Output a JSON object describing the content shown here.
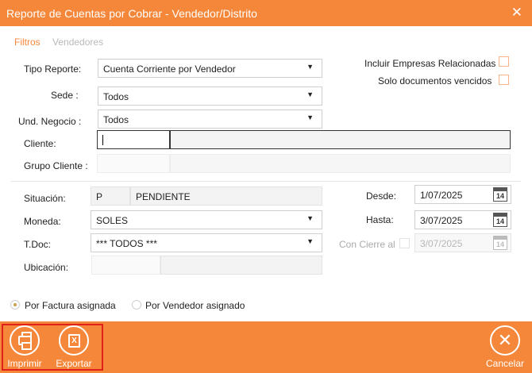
{
  "window": {
    "title": "Reporte de Cuentas por Cobrar - Vendedor/Distrito",
    "close_glyph": "✕"
  },
  "tabs": [
    {
      "label": "Filtros",
      "active": true
    },
    {
      "label": "Vendedores",
      "active": false
    }
  ],
  "form": {
    "tipo_reporte": {
      "label": "Tipo Reporte:",
      "value": "Cuenta Corriente por Vendedor"
    },
    "incluir_empresas": {
      "label": "Incluir Empresas Relacionadas",
      "checked": false
    },
    "solo_vencidos": {
      "label": "Solo documentos vencidos",
      "checked": false
    },
    "sede": {
      "label": "Sede :",
      "value": "Todos"
    },
    "und_negocio": {
      "label": "Und. Negocio :",
      "value": "Todos"
    },
    "cliente": {
      "label": "Cliente:",
      "code": "",
      "name": ""
    },
    "grupo_cliente": {
      "label": "Grupo Cliente :",
      "code": "",
      "name": ""
    },
    "situacion": {
      "label": "Situación:",
      "code": "P",
      "name": "PENDIENTE"
    },
    "moneda": {
      "label": "Moneda:",
      "value": "SOLES"
    },
    "tdoc": {
      "label": "T.Doc:",
      "value": "*** TODOS ***"
    },
    "ubicacion": {
      "label": "Ubicación:",
      "code": "",
      "name": ""
    },
    "desde": {
      "label": "Desde:",
      "value": "1/07/2025"
    },
    "hasta": {
      "label": "Hasta:",
      "value": "3/07/2025"
    },
    "con_cierre": {
      "label": "Con Cierre al",
      "checked": false,
      "value": "3/07/2025"
    },
    "calendar_day": "14",
    "assignment": {
      "options": [
        "Por Factura asignada",
        "Por Vendedor asignado"
      ],
      "selected": "Por Factura asignada"
    }
  },
  "footer": {
    "imprimir": "Imprimir",
    "exportar": "Exportar",
    "cancelar": "Cancelar",
    "excel_glyph": "X"
  },
  "colors": {
    "accent": "#f5873a",
    "highlight": "#e0201a"
  }
}
